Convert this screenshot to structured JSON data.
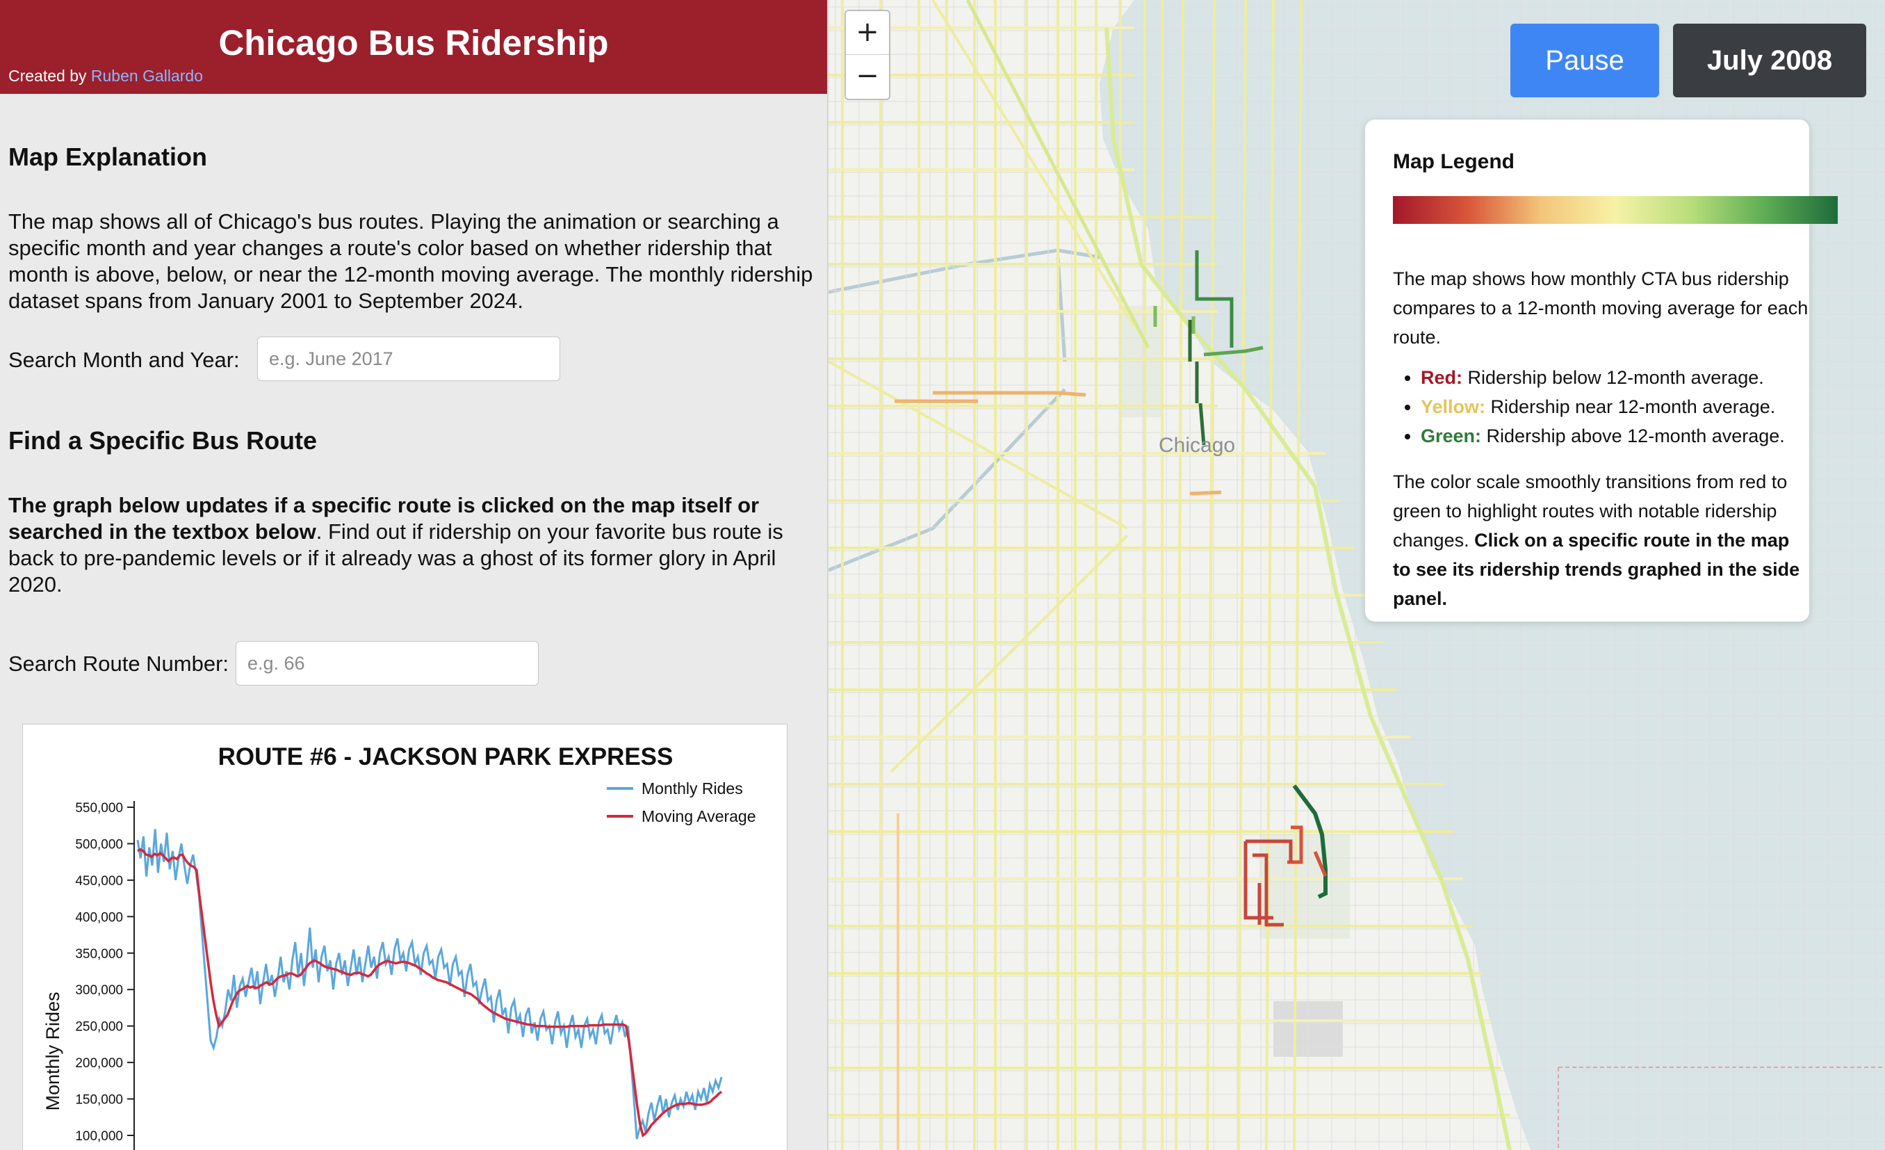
{
  "header": {
    "title": "Chicago Bus Ridership",
    "credit_prefix": "Created by",
    "credit_name": "Ruben Gallardo"
  },
  "map_explanation": {
    "heading": "Map Explanation",
    "body": "The map shows all of Chicago's bus routes. Playing the animation or searching a specific month and year changes a route's color based on whether ridership that month is above, below, or near the 12-month moving average. The monthly ridership dataset spans from January 2001 to September 2024.",
    "search_label": "Search Month and Year:",
    "search_placeholder": "e.g. June 2017"
  },
  "route_finder": {
    "heading": "Find a Specific Bus Route",
    "body_bold": "The graph below updates if a specific route is clicked on the map itself or searched in the textbox below",
    "body_rest": ". Find out if ridership on your favorite bus route is back to pre-pandemic levels or if it already was a ghost of its former glory in April 2020.",
    "search_label": "Search Route Number:",
    "search_placeholder": "e.g. 66"
  },
  "controls": {
    "zoom_in": "+",
    "zoom_out": "−",
    "pause_label": "Pause",
    "current_date": "July 2008"
  },
  "map_labels": {
    "city": "Chicago"
  },
  "legend": {
    "title": "Map Legend",
    "colors": [
      "#a3182a",
      "#d9553a",
      "#f4c57a",
      "#f6f2a6",
      "#b9de7c",
      "#5fae55",
      "#1f6b3a"
    ],
    "description": "The map shows how monthly CTA bus ridership compares to a 12-month moving average for each route.",
    "items": [
      {
        "label": "Red:",
        "text": "Ridership below 12-month average.",
        "color": "#a3182a"
      },
      {
        "label": "Yellow:",
        "text": "Ridership near 12-month average.",
        "color": "#e3c55a"
      },
      {
        "label": "Green:",
        "text": "Ridership above 12-month average.",
        "color": "#2f7a3a"
      }
    ],
    "footer_plain": "The color scale smoothly transitions from red to green to highlight routes with notable ridership changes.",
    "footer_bold": "Click on a specific route in the map to see its ridership trends graphed in the side panel."
  },
  "chart_data": {
    "type": "line",
    "title": "ROUTE #6 - JACKSON PARK EXPRESS",
    "ylabel": "Monthly Rides",
    "xlabel": "",
    "ylim": [
      100000,
      550000
    ],
    "yticks": [
      100000,
      150000,
      200000,
      250000,
      300000,
      350000,
      400000,
      450000,
      500000,
      550000
    ],
    "ytick_labels": [
      "100,000",
      "150,000",
      "200,000",
      "250,000",
      "300,000",
      "350,000",
      "400,000",
      "450,000",
      "500,000",
      "550,000"
    ],
    "legend": "top-right",
    "series": [
      {
        "name": "Monthly Rides",
        "color": "#5aa7dc",
        "values": [
          505000,
          480000,
          510000,
          455000,
          495000,
          470000,
          520000,
          460000,
          500000,
          475000,
          515000,
          465000,
          490000,
          450000,
          480000,
          500000,
          470000,
          445000,
          470000,
          485000,
          460000,
          430000,
          380000,
          330000,
          280000,
          230000,
          220000,
          235000,
          260000,
          250000,
          270000,
          300000,
          285000,
          320000,
          275000,
          305000,
          315000,
          290000,
          310000,
          330000,
          300000,
          325000,
          280000,
          310000,
          335000,
          305000,
          320000,
          290000,
          315000,
          345000,
          310000,
          325000,
          300000,
          340000,
          365000,
          320000,
          350000,
          305000,
          340000,
          385000,
          330000,
          355000,
          310000,
          345000,
          360000,
          325000,
          340000,
          300000,
          335000,
          350000,
          320000,
          340000,
          305000,
          330000,
          355000,
          320000,
          345000,
          310000,
          335000,
          360000,
          330000,
          345000,
          315000,
          350000,
          365000,
          335000,
          345000,
          320000,
          355000,
          370000,
          340000,
          350000,
          325000,
          355000,
          365000,
          335000,
          345000,
          320000,
          350000,
          360000,
          335000,
          340000,
          315000,
          345000,
          355000,
          330000,
          335000,
          305000,
          335000,
          345000,
          320000,
          325000,
          290000,
          320000,
          335000,
          305000,
          310000,
          280000,
          300000,
          315000,
          285000,
          290000,
          255000,
          285000,
          300000,
          265000,
          275000,
          240000,
          275000,
          285000,
          255000,
          265000,
          235000,
          265000,
          275000,
          240000,
          255000,
          230000,
          260000,
          270000,
          245000,
          250000,
          225000,
          255000,
          270000,
          240000,
          250000,
          220000,
          250000,
          265000,
          235000,
          245000,
          220000,
          250000,
          260000,
          235000,
          245000,
          225000,
          255000,
          265000,
          240000,
          245000,
          225000,
          250000,
          265000,
          245000,
          255000,
          235000,
          250000,
          200000,
          150000,
          95000,
          110000,
          120000,
          105000,
          130000,
          145000,
          120000,
          140000,
          155000,
          130000,
          150000,
          125000,
          145000,
          155000,
          135000,
          150000,
          140000,
          160000,
          145000,
          155000,
          135000,
          160000,
          150000,
          165000,
          145000,
          170000,
          160000,
          175000,
          165000,
          180000
        ]
      },
      {
        "name": "Moving Average",
        "color": "#d5283c",
        "values": [
          490000,
          492000,
          490000,
          485000,
          484000,
          482000,
          486000,
          484000,
          487000,
          484000,
          480000,
          476000,
          480000,
          481000,
          479000,
          484000,
          485000,
          478000,
          473000,
          470000,
          468000,
          464000,
          430000,
          400000,
          370000,
          340000,
          310000,
          285000,
          265000,
          250000,
          255000,
          260000,
          265000,
          275000,
          285000,
          292000,
          298000,
          300000,
          302000,
          305000,
          303000,
          304000,
          302000,
          303000,
          306000,
          308000,
          310000,
          307000,
          308000,
          312000,
          316000,
          318000,
          319000,
          320000,
          322000,
          322000,
          320000,
          318000,
          320000,
          325000,
          330000,
          335000,
          338000,
          340000,
          338000,
          336000,
          333000,
          331000,
          330000,
          329000,
          328000,
          327000,
          325000,
          324000,
          322000,
          321000,
          320000,
          322000,
          323000,
          323000,
          321000,
          320000,
          318000,
          320000,
          325000,
          330000,
          334000,
          336000,
          338000,
          339000,
          338000,
          337000,
          336000,
          337000,
          338000,
          338000,
          337000,
          336000,
          334000,
          333000,
          330000,
          328000,
          325000,
          322000,
          320000,
          317000,
          315000,
          313000,
          312000,
          311000,
          310000,
          308000,
          306000,
          304000,
          302000,
          300000,
          298000,
          296000,
          295000,
          293000,
          290000,
          287000,
          283000,
          279000,
          276000,
          273000,
          270000,
          268000,
          266000,
          264000,
          262000,
          260000,
          259000,
          258000,
          257000,
          256000,
          255000,
          254000,
          253000,
          252000,
          252000,
          251000,
          250000,
          250000,
          250000,
          250000,
          249000,
          249000,
          249000,
          249000,
          249000,
          249000,
          249000,
          249000,
          250000,
          250000,
          250000,
          250000,
          250000,
          250000,
          250000,
          251000,
          251000,
          251000,
          251000,
          251000,
          252000,
          252000,
          252000,
          252000,
          252000,
          252000,
          252000,
          252000,
          250000,
          230000,
          200000,
          170000,
          140000,
          115000,
          100000,
          103000,
          108000,
          114000,
          118000,
          122000,
          126000,
          130000,
          133000,
          136000,
          138000,
          140000,
          142000,
          143000,
          143000,
          143000,
          144000,
          144000,
          143000,
          142000,
          142000,
          142000,
          143000,
          144000,
          146000,
          150000,
          153000,
          157000,
          160000
        ]
      }
    ]
  }
}
